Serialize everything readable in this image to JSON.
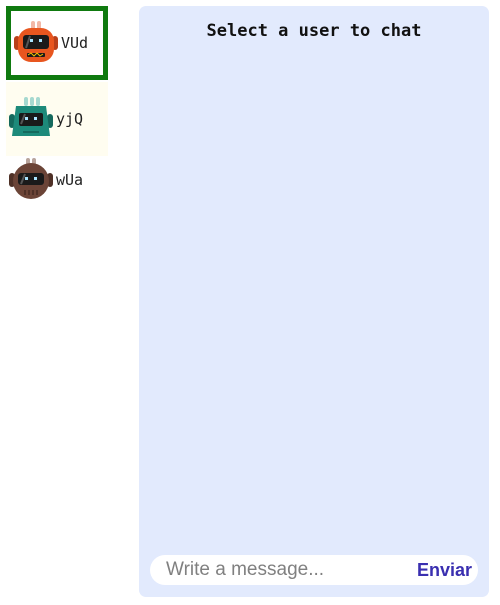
{
  "users": [
    {
      "name": "VUd",
      "selected": true,
      "color": "#e8561f",
      "dark": "#b9401a"
    },
    {
      "name": "yjQ",
      "selected": false,
      "color": "#1d8a7a",
      "dark": "#15695d"
    },
    {
      "name": "wUa",
      "selected": false,
      "color": "#6b4437",
      "dark": "#4f3127"
    }
  ],
  "chat": {
    "title": "Select a user to chat",
    "input_placeholder": "Write a message...",
    "send_label": "Enviar"
  },
  "colors": {
    "selected_border": "#0f7a0f",
    "panel_bg": "#e2eafd",
    "send_text": "#3a2fb0"
  },
  "icons": {
    "avatar": "robot-avatar-icon"
  }
}
